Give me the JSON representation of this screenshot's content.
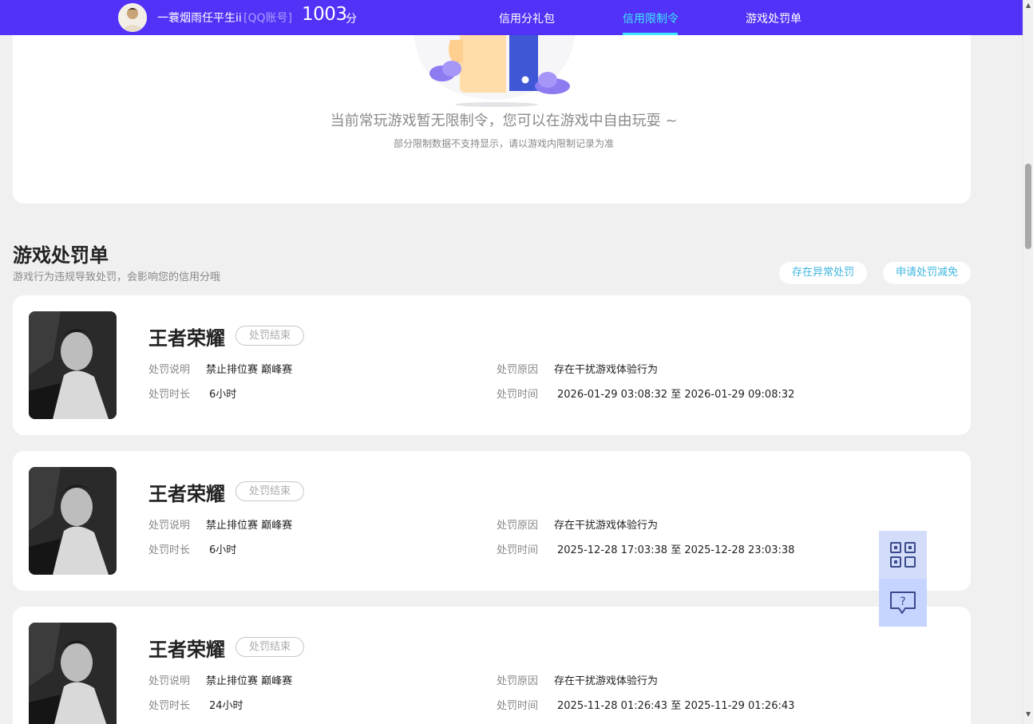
{
  "header": {
    "username": "一蓑烟雨任平生ii",
    "account_type": "[QQ账号]",
    "score": "1003",
    "score_unit": "分",
    "tabs": [
      {
        "label": "信用分礼包",
        "active": false
      },
      {
        "label": "信用限制令",
        "active": true
      },
      {
        "label": "游戏处罚单",
        "active": false
      }
    ]
  },
  "restriction": {
    "message": "当前常玩游戏暂无限制令，您可以在游戏中自由玩耍 ~",
    "note": "部分限制数据不支持显示，请以游戏内限制记录为准"
  },
  "penalties": {
    "title": "游戏处罚单",
    "subtitle": "游戏行为违规导致处罚，会影响您的信用分哦",
    "buttons": {
      "abnormal": "存在异常处罚",
      "appeal": "申请处罚减免"
    },
    "labels": {
      "description": "处罚说明",
      "reason": "处罚原因",
      "duration": "处罚时长",
      "time": "处罚时间"
    },
    "items": [
      {
        "game": "王者荣耀",
        "status": "处罚结束",
        "description": "禁止排位赛 巅峰赛",
        "reason": "存在干扰游戏体验行为",
        "duration": "6小时",
        "time": "2026-01-29 03:08:32 至 2026-01-29 09:08:32"
      },
      {
        "game": "王者荣耀",
        "status": "处罚结束",
        "description": "禁止排位赛 巅峰赛",
        "reason": "存在干扰游戏体验行为",
        "duration": "6小时",
        "time": "2025-12-28 17:03:38 至 2025-12-28 23:03:38"
      },
      {
        "game": "王者荣耀",
        "status": "处罚结束",
        "description": "禁止排位赛 巅峰赛",
        "reason": "存在干扰游戏体验行为",
        "duration": "24小时",
        "time": "2025-11-28 01:26:43 至 2025-11-29 01:26:43"
      }
    ]
  },
  "floating_tools": {
    "icons": [
      "qr-code-icon",
      "help-chat-icon"
    ]
  },
  "colors": {
    "nav_bg": "#5132f6",
    "nav_active": "#3ee7ff",
    "pill_text": "#3fb6e0",
    "page_bg": "#f0f0f0"
  }
}
